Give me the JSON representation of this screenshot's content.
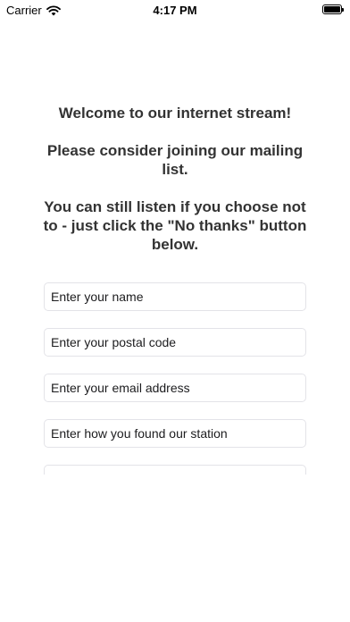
{
  "status_bar": {
    "carrier": "Carrier",
    "time": "4:17 PM",
    "icons": [
      "wifi-icon",
      "battery-icon"
    ]
  },
  "intro": {
    "line1": "Welcome to our internet stream!",
    "line2": "Please consider joining our mailing list.",
    "line3": "You can still listen if you choose not to - just click the \"No thanks\" button below."
  },
  "form": {
    "name_placeholder": "Enter your name",
    "postal_placeholder": "Enter your postal code",
    "email_placeholder": "Enter your email address",
    "source_placeholder": "Enter how you found our station",
    "extra_placeholder": ""
  }
}
